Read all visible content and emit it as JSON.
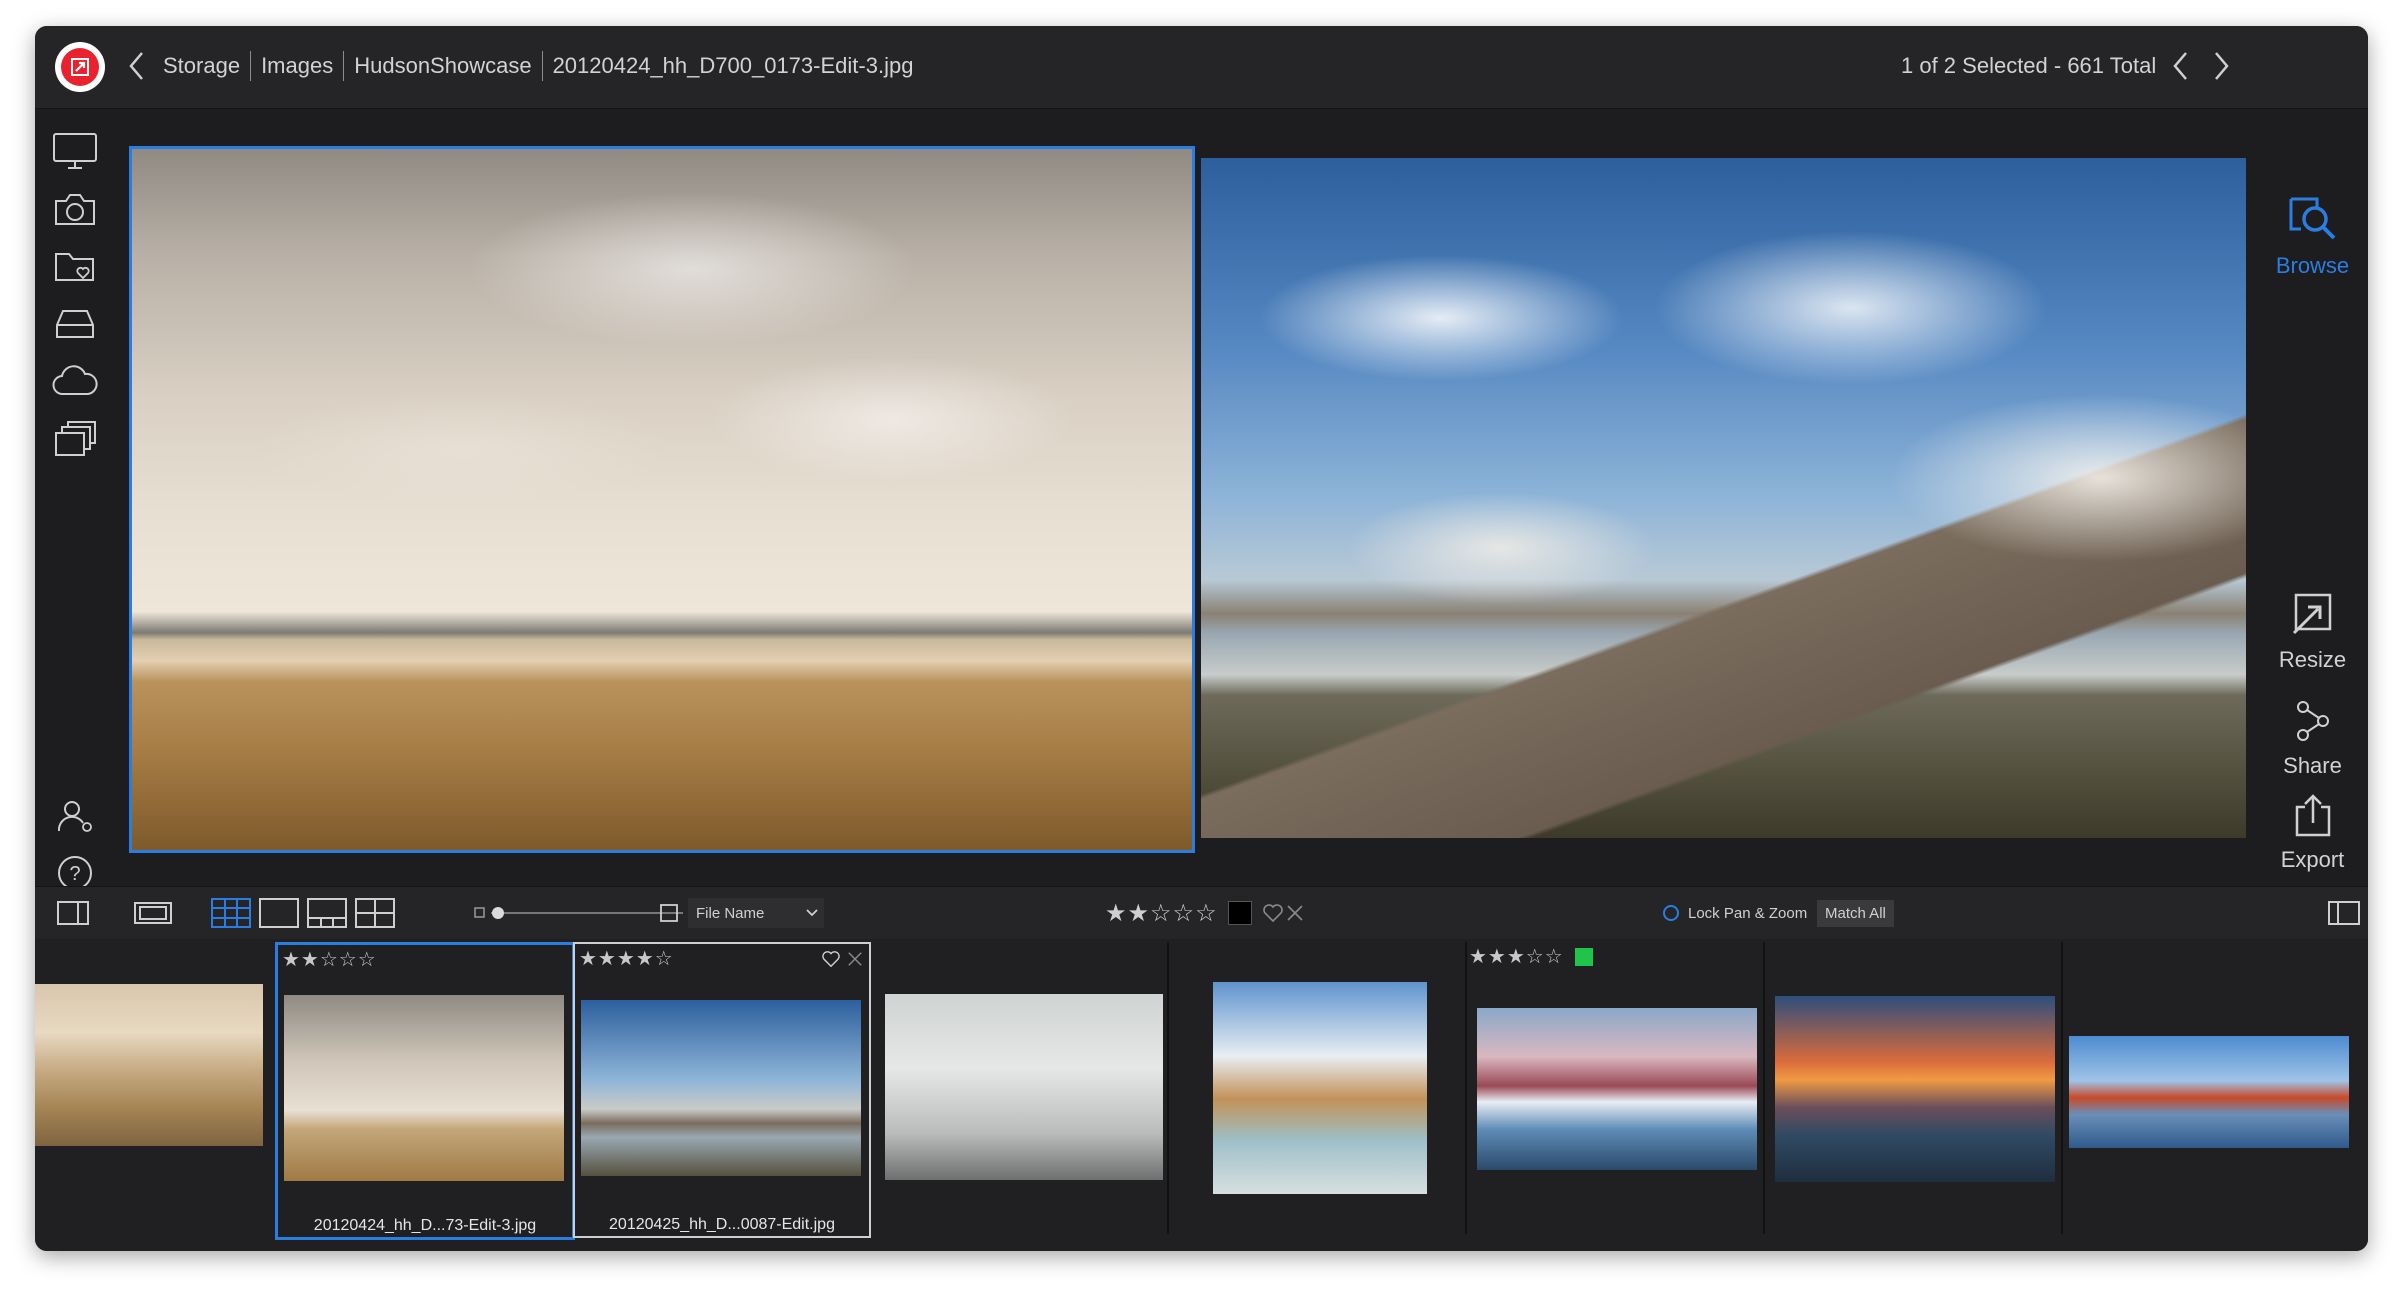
{
  "header": {
    "breadcrumbs": [
      "Storage",
      "Images",
      "HudsonShowcase",
      "20120424_hh_D700_0173-Edit-3.jpg"
    ],
    "selection_text": "1 of 2 Selected - 661 Total"
  },
  "left_sidebar": {
    "items": [
      {
        "icon": "monitor-icon"
      },
      {
        "icon": "camera-icon"
      },
      {
        "icon": "folder-heart-icon"
      },
      {
        "icon": "drive-icon"
      },
      {
        "icon": "cloud-icon"
      },
      {
        "icon": "albums-icon"
      },
      {
        "icon": "user-icon"
      },
      {
        "icon": "help-icon",
        "label": "?"
      }
    ]
  },
  "right_sidebar": {
    "browse_label": "Browse",
    "resize_label": "Resize",
    "share_label": "Share",
    "export_label": "Export",
    "accent": "#2a7de1"
  },
  "toolbar": {
    "sort_label": "File Name",
    "rating_display": "★★☆☆☆",
    "lock_label": "Lock Pan & Zoom",
    "match_all_label": "Match All"
  },
  "filmstrip": {
    "items": [
      {
        "name": "",
        "stars": "",
        "selected": false
      },
      {
        "name": "20120424_hh_D...73-Edit-3.jpg",
        "stars": "★★☆☆☆",
        "selected": true
      },
      {
        "name": "20120425_hh_D...0087-Edit.jpg",
        "stars": "★★★★☆",
        "selected": false
      },
      {
        "name": "",
        "stars": ""
      },
      {
        "name": "",
        "stars": ""
      },
      {
        "name": "",
        "stars": "★★★☆☆",
        "color_label": "#1fc44a"
      },
      {
        "name": "",
        "stars": ""
      },
      {
        "name": "",
        "stars": ""
      }
    ]
  }
}
